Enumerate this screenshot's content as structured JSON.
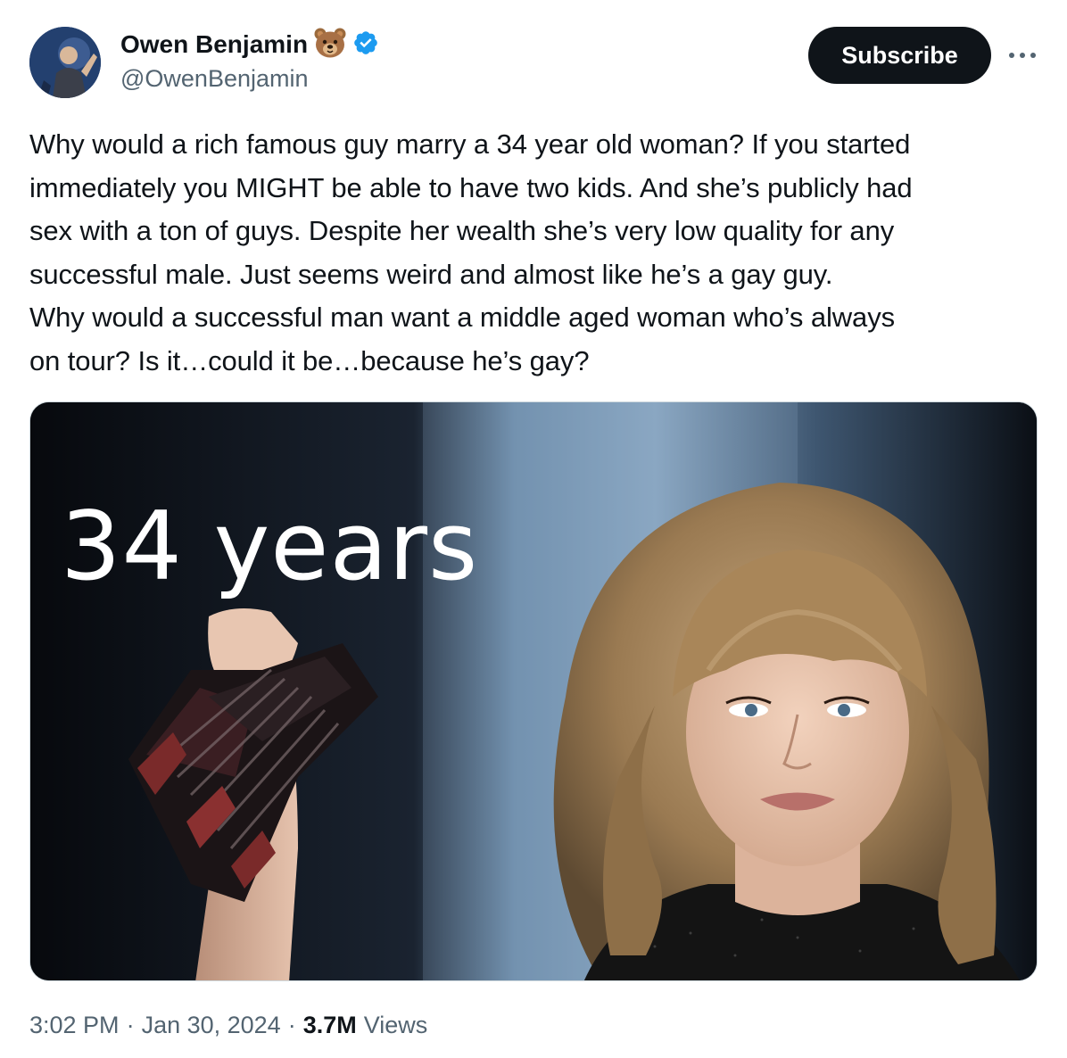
{
  "author": {
    "display_name": "Owen Benjamin",
    "handle": "@OwenBenjamin",
    "name_emoji": "🐻",
    "verified_badge_color": "#1d9bf0",
    "avatar_icon": "user-avatar-photo"
  },
  "actions": {
    "subscribe_label": "Subscribe",
    "more_icon": "more-horizontal-icon"
  },
  "tweet": {
    "lines": [
      "Why would a rich famous guy marry a 34 year old woman? If you started",
      "immediately you MIGHT be able to have two kids. And she’s publicly had",
      "sex with a ton of guys. Despite her wealth she’s very low quality for any",
      "successful male. Just seems weird and almost like he’s a gay guy.",
      "Why would a successful man want a middle aged woman who’s always",
      "on tour? Is it…could it be…because he’s gay?"
    ]
  },
  "media": {
    "overlay_text": "34 years",
    "image_icon": "photo-woman-blonde-bangs-holding-award"
  },
  "meta": {
    "time": "3:02 PM",
    "separator": "·",
    "date": "Jan 30, 2024",
    "views_count": "3.7M",
    "views_label": "Views"
  },
  "colors": {
    "text_primary": "#0f1419",
    "text_secondary": "#536471",
    "button_bg": "#0f1419",
    "border": "#cfd9de"
  }
}
